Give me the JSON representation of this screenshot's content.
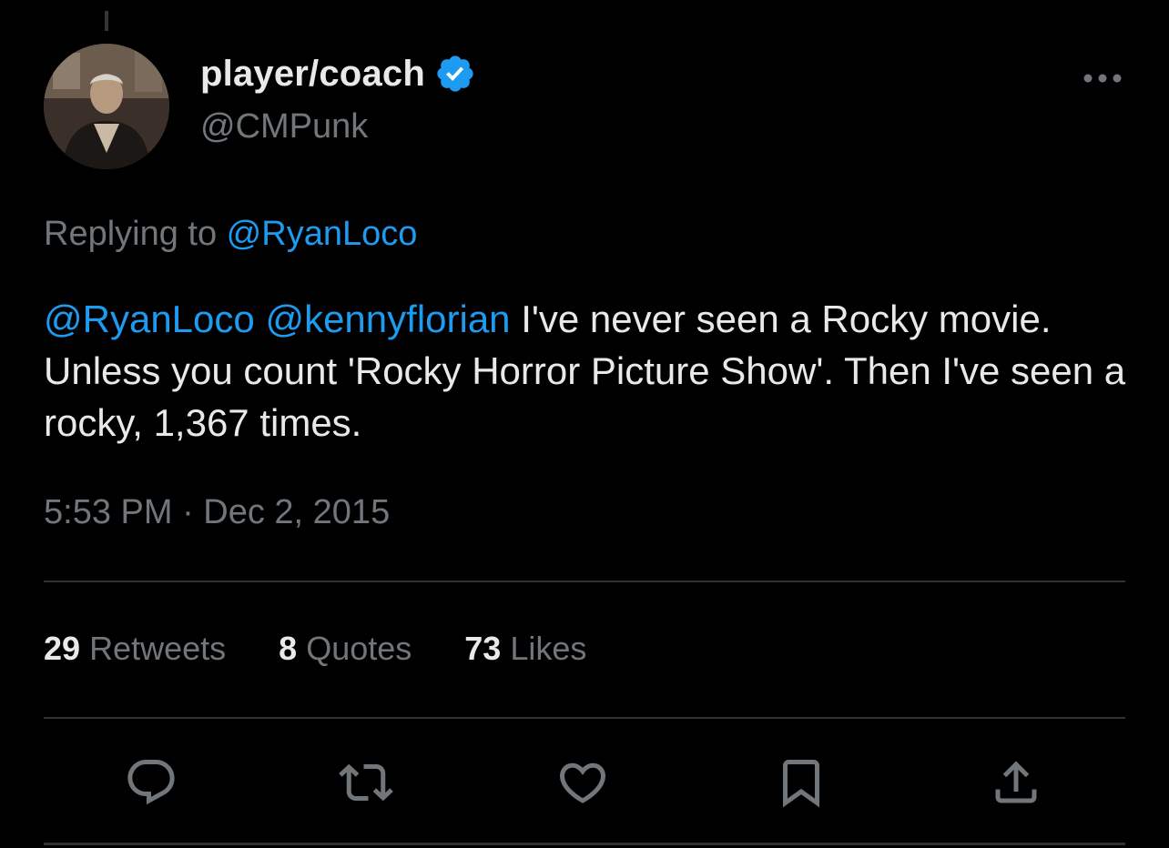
{
  "author": {
    "display_name": "player/coach",
    "handle": "@CMPunk",
    "verified": true,
    "avatar": "avatar-photo"
  },
  "reply": {
    "prefix": "Replying to ",
    "target": "@RyanLoco"
  },
  "tweet": {
    "mention_1": "@RyanLoco",
    "mention_2": "@kennyflorian",
    "body": " I've never seen a Rocky movie. Unless you count 'Rocky Horror Picture Show'. Then I've seen a rocky, 1,367 times."
  },
  "timestamp": "5:53 PM · Dec 2, 2015",
  "stats": {
    "retweets_count": "29",
    "retweets_label": "Retweets",
    "quotes_count": "8",
    "quotes_label": "Quotes",
    "likes_count": "73",
    "likes_label": "Likes"
  },
  "actions": [
    {
      "icon": "reply-icon"
    },
    {
      "icon": "retweet-icon"
    },
    {
      "icon": "like-icon"
    },
    {
      "icon": "bookmark-icon"
    },
    {
      "icon": "share-icon"
    }
  ],
  "colors": {
    "background": "#000000",
    "text": "#e7e9ea",
    "secondary": "#71767b",
    "accent": "#1d9bf0",
    "divider": "#2f3336"
  }
}
